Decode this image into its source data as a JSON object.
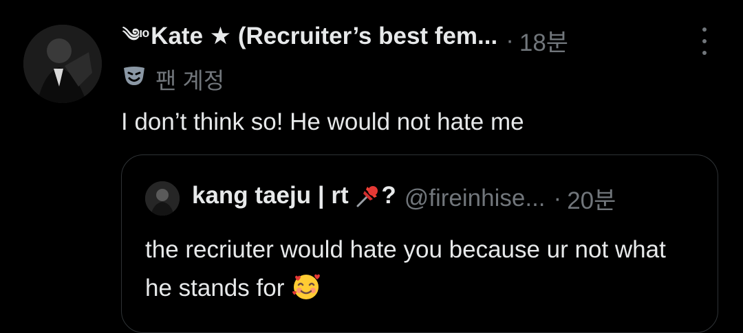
{
  "post": {
    "author_name": "Kate ★ (Recruiter’s best fem...",
    "author_prefix": "༄ᶦᵒ",
    "dot": "·",
    "time": "18분",
    "account_label": "팬 계정",
    "text": "I don’t think so! He would not hate me"
  },
  "quoted": {
    "author_name": "kang taeju | rt",
    "author_suffix": "?",
    "handle": "@fireinhise...",
    "dot": "·",
    "time": "20분",
    "text": "the recriuter would hate you because ur not what he stands for"
  },
  "colors": {
    "background": "#000000",
    "primary_text": "#e7e9ea",
    "secondary_text": "#71767b",
    "border": "#2f3336"
  }
}
